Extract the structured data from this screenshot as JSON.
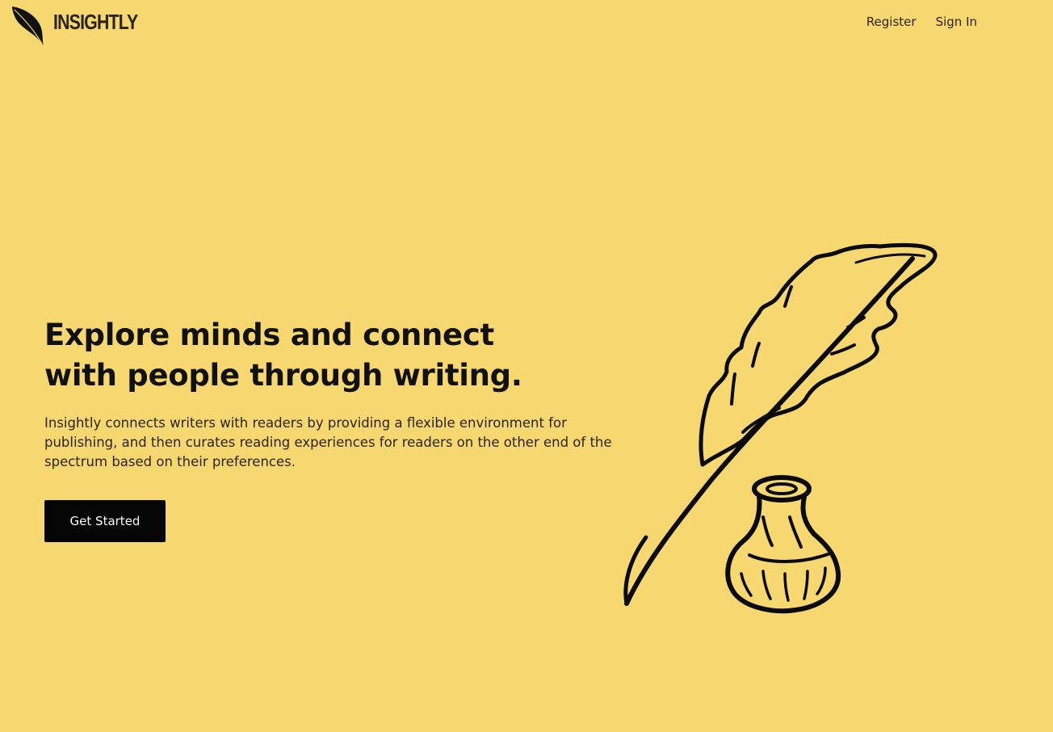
{
  "header": {
    "brand": "INSIGHTLY",
    "nav": {
      "register": "Register",
      "sign_in": "Sign In"
    }
  },
  "hero": {
    "title": "Explore minds and connect with people through writing.",
    "description": "Insightly connects writers with readers by providing a flexible environment for publishing, and then curates reading experiences for readers on the other end of the spectrum based on their preferences.",
    "cta_label": "Get Started"
  },
  "icons": {
    "logo": "feather-quill-icon",
    "illustration": "quill-and-inkwell-illustration"
  },
  "colors": {
    "background": "#f7d76f",
    "text": "#111111",
    "button_bg": "#050505",
    "button_text": "#ffffff"
  }
}
